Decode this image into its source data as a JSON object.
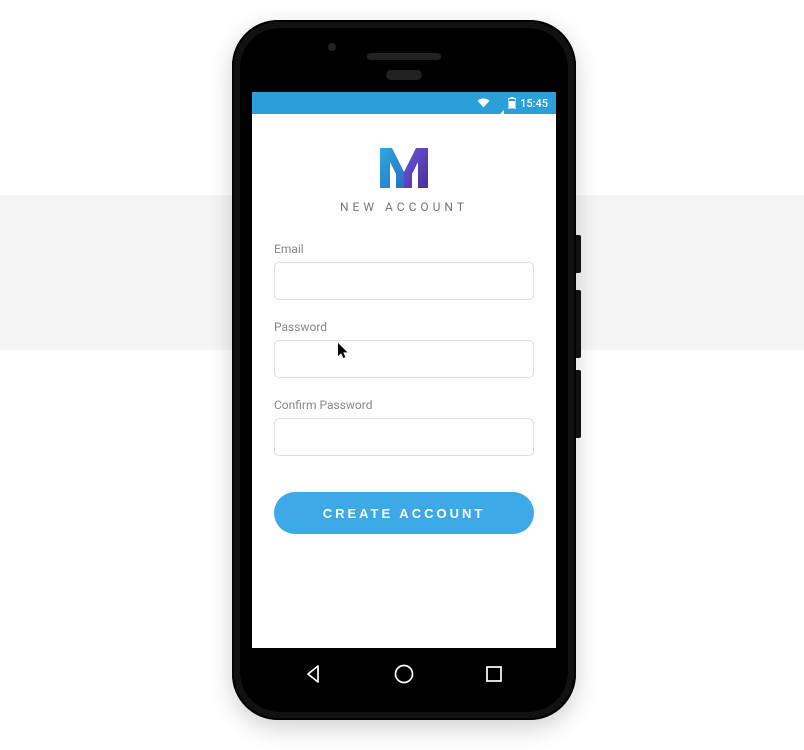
{
  "statusbar": {
    "time": "15:45"
  },
  "header": {
    "subtitle": "NEW ACCOUNT"
  },
  "form": {
    "email_label": "Email",
    "email_value": "",
    "password_label": "Password",
    "password_value": "",
    "confirm_label": "Confirm Password",
    "confirm_value": ""
  },
  "actions": {
    "create_label": "CREATE ACCOUNT"
  },
  "colors": {
    "accent": "#3da9e6",
    "statusbar": "#2a9fd8",
    "logo_blue": "#2a8dd6",
    "logo_purple": "#5b3fa8"
  },
  "icons": {
    "wifi": "wifi-icon",
    "signal": "signal-icon",
    "battery": "battery-icon",
    "nav_back": "triangle-left-icon",
    "nav_home": "circle-icon",
    "nav_recent": "square-icon"
  }
}
